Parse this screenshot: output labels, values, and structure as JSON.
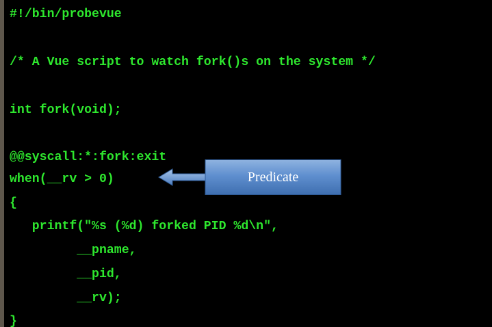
{
  "code": {
    "lines": [
      "#!/bin/probevue",
      "/* A Vue script to watch fork()s on the system */",
      "int fork(void);",
      "@@syscall:*:fork:exit",
      "when(__rv > 0)",
      "{",
      "   printf(\"%s (%d) forked PID %d\\n\",",
      "         __pname,",
      "         __pid,",
      "         __rv);",
      "}"
    ]
  },
  "callout": {
    "label": "Predicate",
    "arrow_icon": "left-arrow-icon"
  },
  "colors": {
    "background": "#000000",
    "code_text": "#2ee82e",
    "callout_fill": "#4f81bd",
    "callout_text": "#ffffff",
    "window_border": "#5e574c"
  }
}
